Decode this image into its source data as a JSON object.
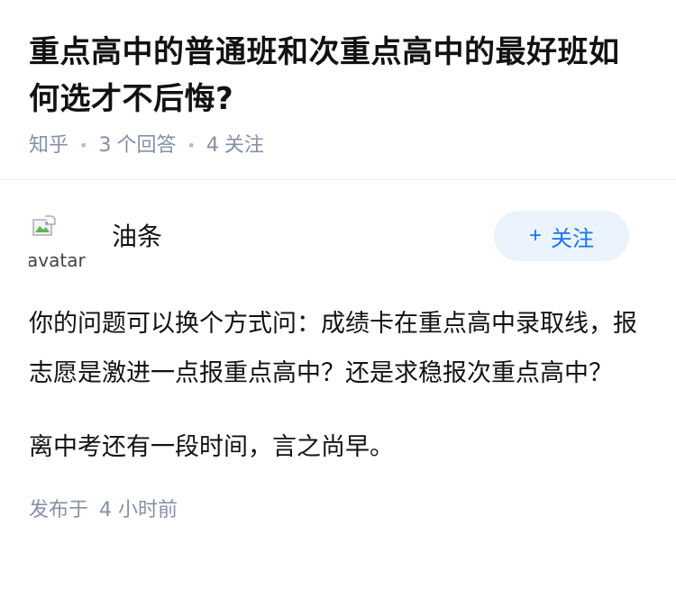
{
  "question": {
    "title": "重点高中的普通班和次重点高中的最好班如何选才不后悔?",
    "source": "知乎",
    "answer_count": "3",
    "answer_label": "个回答",
    "follower_count": "4",
    "follower_label": "关注"
  },
  "answer": {
    "avatar_alt": "avatar",
    "author": "油条",
    "follow_label": "关注",
    "follow_plus": "+",
    "paragraphs": [
      "你的问题可以换个方式问：成绩卡在重点高中录取线，报志愿是激进一点报重点高中？还是求稳报次重点高中？",
      "离中考还有一段时间，言之尚早。"
    ],
    "time_prefix": "发布于",
    "time_value": "4 小时前"
  },
  "colors": {
    "meta": "#8590a6",
    "accent": "#1772f6",
    "follow_bg": "#ebf3fc"
  }
}
